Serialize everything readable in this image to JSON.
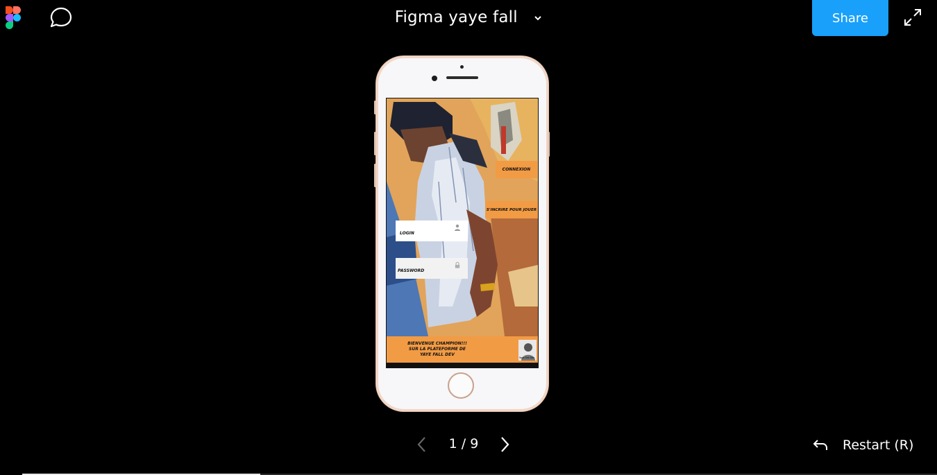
{
  "header": {
    "title": "Figma yaye fall",
    "share_label": "Share"
  },
  "icons": {
    "logo": "figma-logo-icon",
    "comment": "comment-bubble-icon",
    "caret": "chevron-down-icon",
    "fullscreen": "expand-icon",
    "prev": "chevron-left-icon",
    "next": "chevron-right-icon",
    "restart": "undo-arrow-icon"
  },
  "prototype": {
    "connexion_label": "CONNEXION",
    "inscrire_label": "S'INCRIRE POUR JOUER",
    "login_label": "LOGIN",
    "password_label": "PASSWORD",
    "welcome_lines": [
      "BIENVENUE CHAMPION!!!",
      "SUR LA PLATEFORME DE",
      "YAYE FALL DEV"
    ],
    "badge_text": "Yaye Fall Dev"
  },
  "navigation": {
    "page_counter": "1 / 9",
    "restart_label": "Restart (R)",
    "progress_fraction": 0.26
  },
  "colors": {
    "accent": "#18a0fb",
    "background": "#000000",
    "prototype_orange": "#f29b45"
  }
}
